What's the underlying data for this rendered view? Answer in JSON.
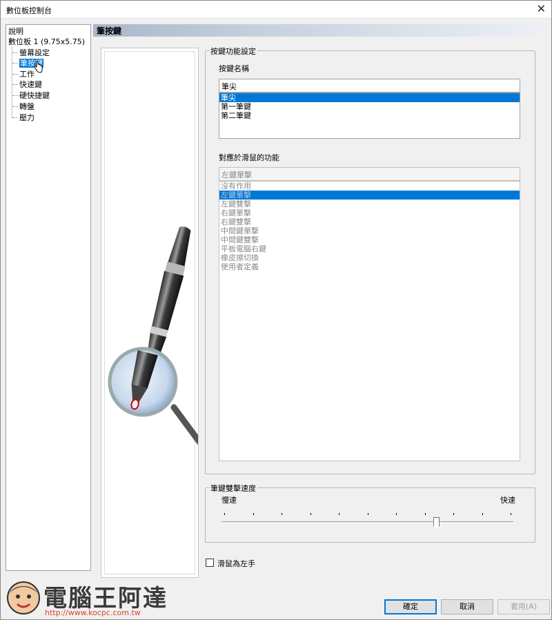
{
  "window": {
    "title": "數位板控制台",
    "close_glyph": "✕"
  },
  "tree": {
    "items": [
      {
        "label": "說明"
      },
      {
        "label": "數位板 1 (9.75x5.75)"
      },
      {
        "label": "螢幕設定"
      },
      {
        "label": "筆按鍵"
      },
      {
        "label": "工作"
      },
      {
        "label": "快速鍵"
      },
      {
        "label": "硬快捷鍵"
      },
      {
        "label": "轉盤"
      },
      {
        "label": "壓力"
      }
    ]
  },
  "section": {
    "title": "筆按鍵"
  },
  "button_settings": {
    "group_title": "按鍵功能設定",
    "name_label": "按鍵名稱",
    "name_value": "筆尖",
    "name_options": [
      "筆尖",
      "第一筆鍵",
      "第二筆鍵"
    ],
    "mouse_label": "對應於滑鼠的功能",
    "mouse_value": "左鍵單擊",
    "mouse_options": [
      "沒有作用",
      "左鍵單擊",
      "左鍵雙擊",
      "右鍵單擊",
      "右鍵雙擊",
      "中間鍵單擊",
      "中間鍵雙擊",
      "平板電腦右鍵",
      "橡皮擦切換",
      "使用者定義"
    ]
  },
  "double_click": {
    "group_title": "筆鍵雙擊速度",
    "slow_label": "慢速",
    "fast_label": "快速",
    "value_fraction": 0.74
  },
  "left_hand": {
    "label": "滑鼠為左手",
    "checked": false
  },
  "buttons": {
    "ok": "確定",
    "cancel": "取消",
    "apply": "套用(A)"
  },
  "watermark": {
    "title": "電腦王阿達",
    "url": "http://www.kocpc.com.tw"
  },
  "colors": {
    "selection": "#0078d7",
    "header_gradient_start": "#a9b7c9"
  }
}
